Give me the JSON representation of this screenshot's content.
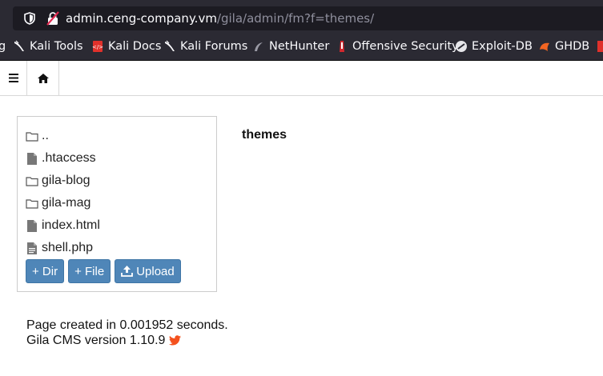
{
  "browser": {
    "url_host": "admin.ceng-company.vm",
    "url_path": "/gila/admin/fm?f=themes/"
  },
  "bookmarks": [
    {
      "label": "g",
      "icon": "none"
    },
    {
      "label": "Kali Tools",
      "icon": "kali-dragon-icon"
    },
    {
      "label": "Kali Docs",
      "icon": "kali-docs-icon"
    },
    {
      "label": "Kali Forums",
      "icon": "kali-dragon-icon"
    },
    {
      "label": "NetHunter",
      "icon": "nethunter-icon"
    },
    {
      "label": "Offensive Security",
      "icon": "offsec-icon"
    },
    {
      "label": "Exploit-DB",
      "icon": "exploitdb-icon"
    },
    {
      "label": "GHDB",
      "icon": "ghdb-icon"
    }
  ],
  "nav": {
    "menu_icon": "hamburger-icon",
    "home_icon": "home-icon"
  },
  "filemanager": {
    "items": [
      {
        "name": "..",
        "type": "folder"
      },
      {
        "name": ".htaccess",
        "type": "file"
      },
      {
        "name": "gila-blog",
        "type": "folder"
      },
      {
        "name": "gila-mag",
        "type": "folder"
      },
      {
        "name": "index.html",
        "type": "file"
      },
      {
        "name": "shell.php",
        "type": "file-text"
      }
    ],
    "buttons": {
      "dir": "+ Dir",
      "file": "+ File",
      "upload": "Upload"
    },
    "current_folder": "themes"
  },
  "footer": {
    "page_created": "Page created in 0.001952 seconds.",
    "version": "Gila CMS version 1.10.9"
  },
  "colors": {
    "button_bg": "#4f86b8",
    "browser_bar": "#2b2a33",
    "twitter_accent": "#f4511e"
  }
}
